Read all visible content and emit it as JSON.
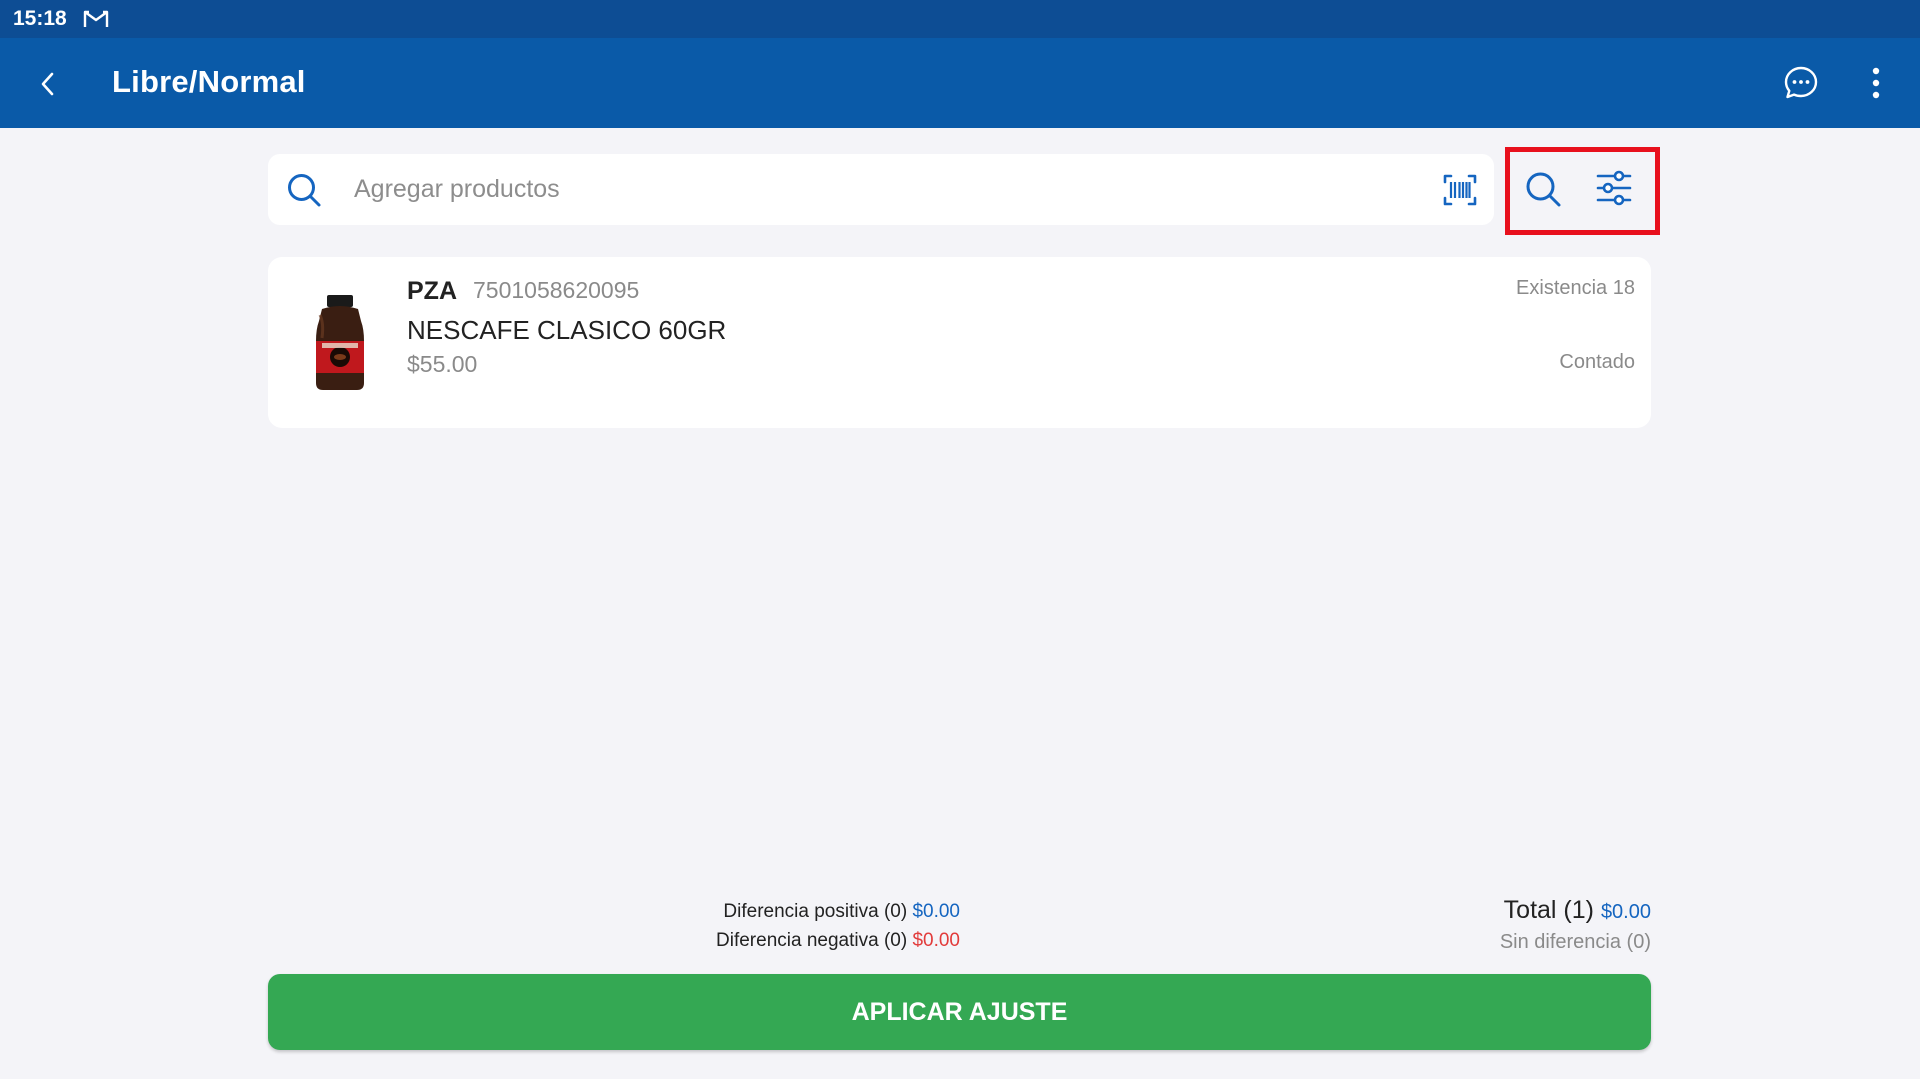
{
  "status_bar": {
    "time": "15:18",
    "notification_icon": "gmail-icon"
  },
  "app_bar": {
    "title": "Libre/Normal",
    "back_icon": "chevron-left-icon",
    "chat_icon": "chat-bubble-icon",
    "more_icon": "more-vertical-icon"
  },
  "search": {
    "placeholder": "Agregar productos",
    "value": "",
    "barcode_icon": "barcode-scan-icon",
    "search_icon": "search-icon",
    "filter_icon": "sliders-icon"
  },
  "products": [
    {
      "unit": "PZA",
      "code": "7501058620095",
      "name": "NESCAFE CLASICO 60GR",
      "price": "$55.00",
      "stock": "Existencia 18",
      "status": "Contado"
    }
  ],
  "summary": {
    "positive_label": "Diferencia positiva (0)",
    "positive_value": "$0.00",
    "negative_label": "Diferencia negativa (0)",
    "negative_value": "$0.00",
    "total_label": "Total (1)",
    "total_value": "$0.00",
    "no_diff_label": "Sin diferencia (0)"
  },
  "apply_button": "APLICAR AJUSTE",
  "colors": {
    "status_bar": "#0d4d94",
    "app_bar": "#0a5aa8",
    "accent_blue": "#1565c0",
    "negative_red": "#e23b3b",
    "apply_green": "#34a853",
    "highlight_red": "#e8101d"
  }
}
